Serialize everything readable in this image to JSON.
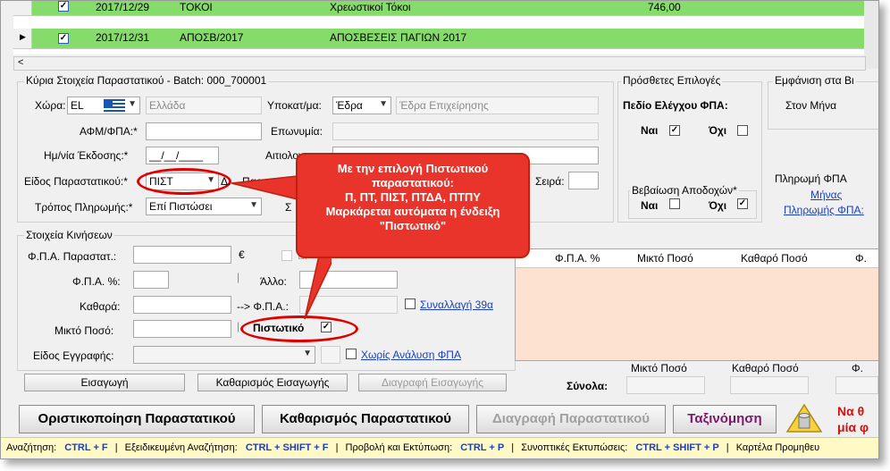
{
  "grid": {
    "rows": [
      {
        "date": "2017/12/29",
        "code": "ΤΟΚΟΙ",
        "desc": "Χρεωστικοί Τόκοι",
        "amount": "746,00"
      },
      {
        "date": "2017/12/31",
        "code": "ΑΠΟΣΒ/2017",
        "desc": "ΑΠΟΣΒΕΣΕΙΣ ΠΑΓΙΩΝ 2017",
        "amount": ""
      }
    ]
  },
  "main_info": {
    "title": "Κύρια Στοιχεία Παραστατικού - Batch: 000_700001",
    "country_label": "Χώρα:",
    "country_code": "EL",
    "country_name": "Ελλάδα",
    "branch_label": "Υποκατ/μα:",
    "branch_value": "Έδρα",
    "branch_name": "Έδρα Επιχείρησης",
    "afm_label": "ΑΦΜ/ΦΠΑ:*",
    "name_label": "Επωνυμία:",
    "date_label": "Ημ/νία Έκδοσης:*",
    "date_placeholder": "__/__/____",
    "reason_label": "Αιτιολογ",
    "doctype_label": "Είδος Παραστατικού:*",
    "doctype_value": "ΠΙΣΤ",
    "doc_label_partial": "Παραστα",
    "series_label": "Σειρά:",
    "payment_label": "Τρόπος Πληρωμής:*",
    "payment_value": "Επί Πιστώσει",
    "s_label": "Σ"
  },
  "extra_options": {
    "title": "Πρόσθετες Επιλογές",
    "vat_check_title": "Πεδίο Ελέγχου ΦΠΑ:",
    "yes": "Ναι",
    "no": "Όχι",
    "withholding_title": "Βεβαίωση Αποδοχών*",
    "yes2": "Ναι",
    "no2": "Όχι"
  },
  "display_group": {
    "title": "Εμφάνιση στα Βι",
    "value": "Στον Μήνα"
  },
  "vat_payment": {
    "title": "Πληρωμή ΦΠΑ",
    "month_link": "Μήνας",
    "payment_link": "Πληρωμής ΦΠΑ:"
  },
  "movements": {
    "title": "Στοιχεία Κινήσεων",
    "vat_doc_label": "Φ.Π.Α. Παραστατ.:",
    "euro": "€",
    "ei_label": "Ει",
    "vat_pct_label": "Φ.Π.Α. %:",
    "other_label": "Άλλο:",
    "net_label": "Καθαρά:",
    "arrow_vat_label": "--> Φ.Π.Α.:",
    "transaction_link": "Συναλλαγή 39α",
    "gross_label": "Μικτό Ποσό:",
    "credit_label": "Πιστωτικό",
    "entry_type_label": "Είδος Εγγραφής:",
    "no_vat_link": "Χωρίς Ανάλυση ΦΠΑ"
  },
  "table": {
    "headers": [
      "Φ.Π.Α. %",
      "Μικτό Ποσό",
      "Καθαρό Ποσό",
      "Φ."
    ]
  },
  "buttons": {
    "insert": "Εισαγωγή",
    "clear_insert": "Καθαρισμός Εισαγωγής",
    "delete_insert": "Διαγραφή Εισαγωγής",
    "finalize": "Οριστικοποίηση Παραστατικού",
    "clear_doc": "Καθαρισμός Παραστατικού",
    "delete_doc": "Διαγραφή Παραστατικού",
    "sort": "Ταξινόμηση"
  },
  "totals": {
    "label": "Σύνολα:",
    "gross": "Μικτό Ποσό",
    "net": "Καθαρό Ποσό",
    "vat": "Φ."
  },
  "warning": {
    "line1": "Να θ",
    "line2": "μία φ"
  },
  "callout": {
    "line1": "Με την επιλογή Πιστωτικού",
    "line2": "παραστατικού:",
    "line3": "Π, ΠΤ, ΠΙΣΤ, ΠΤΔΑ, ΠΤΠΥ",
    "line4": "Μαρκάρεται αυτόματα η ένδειξη",
    "line5": "\"Πιστωτικό\""
  },
  "shortcuts": [
    {
      "label": "Αναζήτηση:",
      "key": "CTRL + F"
    },
    {
      "label": "Εξειδικευμένη Αναζήτηση:",
      "key": "CTRL + SHIFT + F"
    },
    {
      "label": "Προβολή και Εκτύπωση:",
      "key": "CTRL + P"
    },
    {
      "label": "Συνοπτικές Εκτυπώσεις:",
      "key": "CTRL + SHIFT + P"
    },
    {
      "label": "Καρτέλα Προμηθευ",
      "key": ""
    }
  ],
  "colors": {
    "grid_green": "#86dc6a",
    "callout_red": "#e8342a",
    "link_blue": "#1a3fbf",
    "table_bg": "#fde2d2"
  }
}
